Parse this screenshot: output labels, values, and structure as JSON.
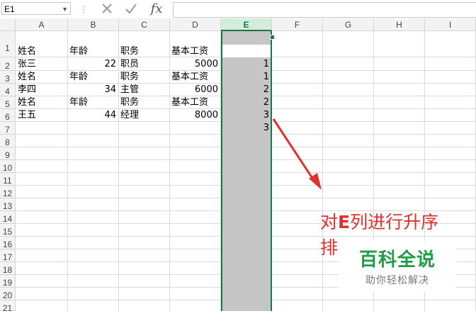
{
  "formula_bar": {
    "name_box": "E1",
    "fx_label": "fx",
    "formula_value": ""
  },
  "columns": [
    "A",
    "B",
    "C",
    "D",
    "E",
    "F",
    "G",
    "H",
    "I"
  ],
  "selected_column": "E",
  "rows": [
    "1",
    "2",
    "3",
    "4",
    "5",
    "6",
    "7",
    "8",
    "9",
    "10",
    "11",
    "12",
    "13",
    "14",
    "15",
    "16",
    "17",
    "18",
    "19",
    "20",
    "21"
  ],
  "cells": {
    "r1": {
      "a": "姓名",
      "b": "年龄",
      "c": "职务",
      "d": "基本工资"
    },
    "r2": {
      "a": "张三",
      "b": "22",
      "c": "职员",
      "d": "5000",
      "e": "1"
    },
    "r3": {
      "a": "姓名",
      "b": "年龄",
      "c": "职务",
      "d": "基本工资",
      "e": "1"
    },
    "r4": {
      "a": "李四",
      "b": "34",
      "c": "主管",
      "d": "6000",
      "e": "2"
    },
    "r5": {
      "a": "姓名",
      "b": "年龄",
      "c": "职务",
      "d": "基本工资",
      "e": "2"
    },
    "r6": {
      "a": "王五",
      "b": "44",
      "c": "经理",
      "d": "8000",
      "e": "3"
    },
    "r7": {
      "e": "3"
    }
  },
  "annotation": {
    "line1_pre": "对",
    "line1_bold": "E",
    "line1_post": "列进行升序",
    "line2": "排"
  },
  "watermark": {
    "title": "百科全说",
    "subtitle": "助你轻松解决"
  },
  "colors": {
    "excel_green": "#217346",
    "selection_gray": "#c6c6c6",
    "annotation_red": "#e03030",
    "watermark_green": "#1e9c46"
  }
}
